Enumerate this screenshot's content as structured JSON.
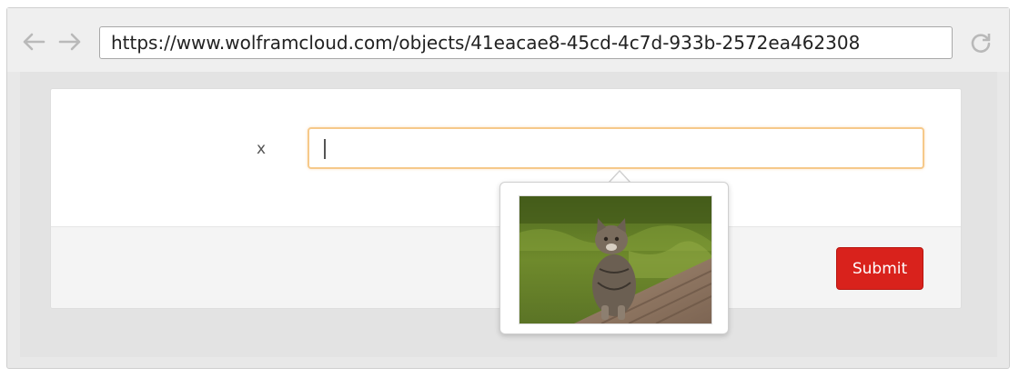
{
  "browser": {
    "url": "https://www.wolframcloud.com/objects/41eacae8-45cd-4c7d-933b-2572ea462308",
    "back_icon": "arrow-left-icon",
    "forward_icon": "arrow-right-icon",
    "reload_icon": "reload-icon"
  },
  "form": {
    "field_label": "x",
    "input_value": "",
    "submit_label": "Submit"
  },
  "popover": {
    "image": "cat-photo"
  },
  "colors": {
    "submit": "#d9221c",
    "input_focus_border": "#f6c98a"
  }
}
